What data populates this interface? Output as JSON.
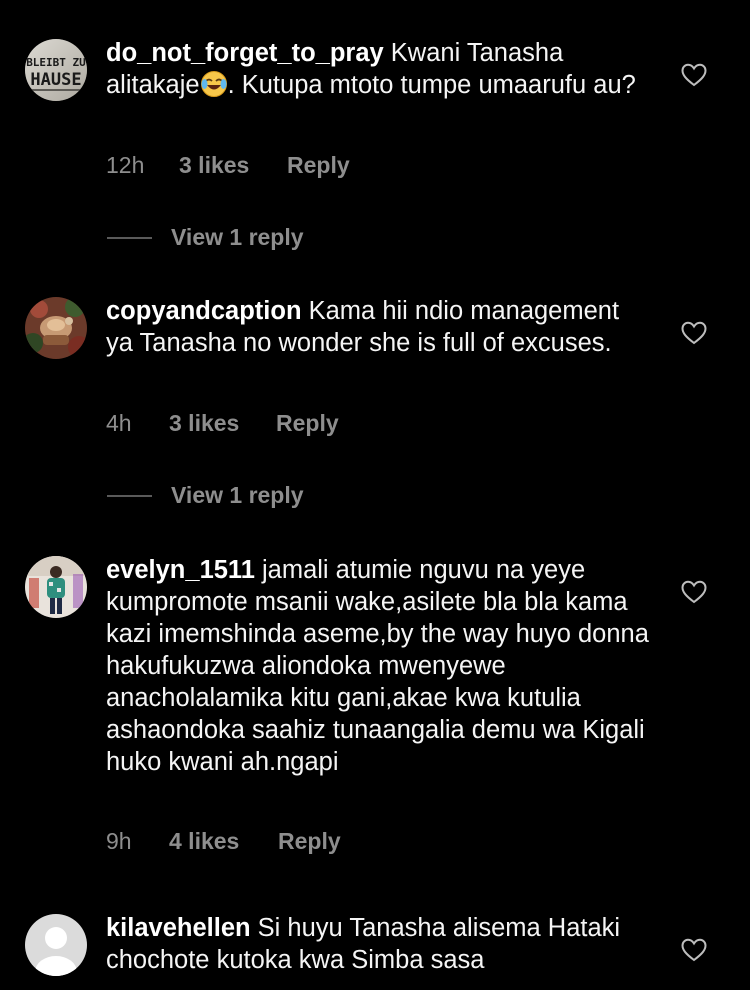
{
  "colors": {
    "background": "#000000",
    "text": "#f5f5f5",
    "muted": "#8e8e8e",
    "divider": "#5a5a5a"
  },
  "comments": [
    {
      "username": "do_not_forget_to_pray",
      "text_part1": " Kwani Tanasha alitakaje",
      "emoji": "joy-emoji",
      "text_part2": ". Kutupa mtoto tumpe umaarufu au?",
      "time": "12h",
      "likes": "3 likes",
      "reply": "Reply",
      "view_replies": "View 1 reply",
      "avatar_text_top": "BLEIBT ZU",
      "avatar_text_bottom": "HAUSE",
      "heart_icon": "heart-outline-icon"
    },
    {
      "username": "copyandcaption",
      "text": " Kama hii ndio management ya Tanasha no wonder she is full of excuses.",
      "time": "4h",
      "likes": "3 likes",
      "reply": "Reply",
      "view_replies": "View 1 reply",
      "heart_icon": "heart-outline-icon"
    },
    {
      "username": "evelyn_1511",
      "text": " jamali atumie nguvu na yeye kumpromote msanii wake,asilete bla bla kama kazi imemshinda aseme,by the way huyo donna hakufukuzwa aliondoka mwenyewe anacholalamika kitu gani,akae kwa kutulia ashaondoka saahiz tunaangalia demu wa Kigali huko kwani ah.ngapi",
      "time": "9h",
      "likes": "4 likes",
      "reply": "Reply",
      "heart_icon": "heart-outline-icon"
    },
    {
      "username": "kilavehellen",
      "text": " Si huyu Tanasha alisema Hataki chochote kutoka kwa Simba sasa",
      "heart_icon": "heart-outline-icon"
    }
  ]
}
